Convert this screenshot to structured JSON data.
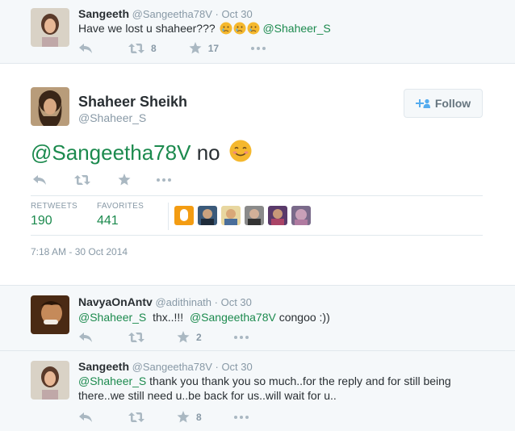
{
  "parent_tweet": {
    "name": "Sangeeth",
    "handle": "@Sangeetha78V",
    "time": "· Oct 30",
    "text": "Have we lost u shaheer???",
    "mention": "@Shaheer_S",
    "retweets": "8",
    "favorites": "17"
  },
  "main_tweet": {
    "name": "Shaheer Sheikh",
    "handle": "@Shaheer_S",
    "follow_label": "Follow",
    "mention": "@Sangeetha78V",
    "text": "no",
    "stats": {
      "retweets_label": "RETWEETS",
      "retweets": "190",
      "favorites_label": "FAVORITES",
      "favorites": "441"
    },
    "datetime": "7:18 AM - 30 Oct 2014"
  },
  "reply1": {
    "name": "NavyaOnAntv",
    "handle": "@adithinath",
    "time": "· Oct 30",
    "mention1": "@Shaheer_S",
    "text1": "thx..!!!",
    "mention2": "@Sangeetha78V",
    "text2": "congoo :))",
    "retweets": "",
    "favorites": "2"
  },
  "reply2": {
    "name": "Sangeeth",
    "handle": "@Sangeetha78V",
    "time": "· Oct 30",
    "mention": "@Shaheer_S",
    "text_line1": "thank you thank you so much..for the reply and for still being",
    "text_line2": "there..we still need u..be back for us..will wait for u..",
    "retweets": "",
    "favorites": "8"
  },
  "colors": {
    "link": "#1c8a4e",
    "muted": "#8899a6",
    "text": "#292f33"
  },
  "icons": [
    "reply-icon",
    "retweet-icon",
    "favorite-icon",
    "more-icon",
    "follow-person-icon",
    "smile-emoji-icon",
    "crying-emoji-icon"
  ]
}
